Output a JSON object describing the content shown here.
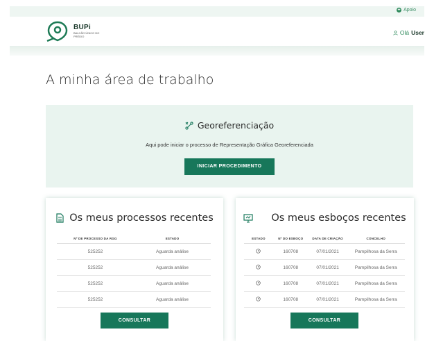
{
  "topbar": {
    "apoio_label": "Apoio"
  },
  "header": {
    "brand_name": "BUPi",
    "brand_sub": "BALCÃO ÚNICO DO PRÉDIO",
    "greeting": "Olá",
    "user_name": "User"
  },
  "page": {
    "title": "A minha área de trabalho"
  },
  "geo": {
    "title": "Georeferenciação",
    "description": "Aqui pode iniciar o processo de Representação Gráfica Georeferenciada",
    "button_label": "INICIAR PROCEDIMENTO"
  },
  "processos": {
    "title": "Os meus processos recentes",
    "columns": [
      "Nº DE PROCESSO DA RGG",
      "ESTADO"
    ],
    "rows": [
      {
        "numero": "525252",
        "estado": "Aguarda análise"
      },
      {
        "numero": "525252",
        "estado": "Aguarda análise"
      },
      {
        "numero": "525252",
        "estado": "Aguarda análise"
      },
      {
        "numero": "525252",
        "estado": "Aguarda análise"
      }
    ],
    "button_label": "CONSULTAR"
  },
  "esbocos": {
    "title": "Os meus esboços recentes",
    "columns": [
      "ESTADO",
      "Nº DO ESBOÇO",
      "DATA DE CRIAÇÃO",
      "CONCELHO"
    ],
    "rows": [
      {
        "numero": "160708",
        "data": "07/01/2021",
        "concelho": "Pampilhosa da Serra"
      },
      {
        "numero": "160708",
        "data": "07/01/2021",
        "concelho": "Pampilhosa da Serra"
      },
      {
        "numero": "160708",
        "data": "07/01/2021",
        "concelho": "Pampilhosa da Serra"
      },
      {
        "numero": "160708",
        "data": "07/01/2021",
        "concelho": "Pampilhosa da Serra"
      }
    ],
    "button_label": "CONSULTAR"
  },
  "colors": {
    "primary": "#17775a",
    "accent_bg": "#e9f4ef"
  }
}
